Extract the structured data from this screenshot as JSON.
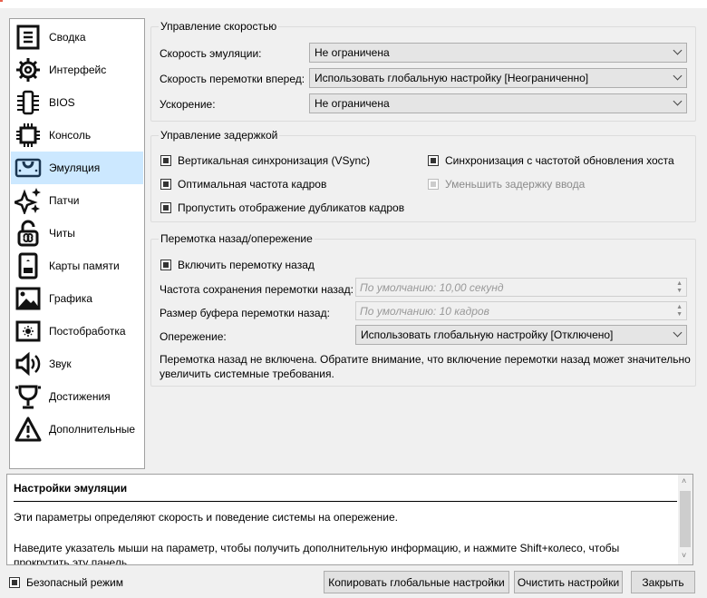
{
  "sidebar": {
    "items": [
      {
        "label": "Сводка",
        "icon": "summary-icon"
      },
      {
        "label": "Интерфейс",
        "icon": "gear-icon"
      },
      {
        "label": "BIOS",
        "icon": "bios-chip-icon"
      },
      {
        "label": "Консоль",
        "icon": "console-chip-icon"
      },
      {
        "label": "Эмуляция",
        "icon": "emulation-icon"
      },
      {
        "label": "Патчи",
        "icon": "sparkle-icon"
      },
      {
        "label": "Читы",
        "icon": "cheats-lock-icon"
      },
      {
        "label": "Карты памяти",
        "icon": "memory-card-icon"
      },
      {
        "label": "Графика",
        "icon": "image-icon"
      },
      {
        "label": "Постобработка",
        "icon": "post-processing-icon"
      },
      {
        "label": "Звук",
        "icon": "speaker-icon"
      },
      {
        "label": "Достижения",
        "icon": "trophy-icon"
      },
      {
        "label": "Дополнительные",
        "icon": "warning-icon"
      }
    ],
    "selected": "Эмуляция"
  },
  "speed": {
    "title": "Управление скоростью",
    "emulation_label": "Скорость эмуляции:",
    "emulation_value": "Не ограничена",
    "ff_label": "Скорость перемотки вперед:",
    "ff_value": "Использовать глобальную настройку [Неограниченно]",
    "turbo_label": "Ускорение:",
    "turbo_value": "Не ограничена"
  },
  "latency": {
    "title": "Управление задержкой",
    "vsync": "Вертикальная синхронизация (VSync)",
    "host_sync": "Синхронизация с частотой обновления хоста",
    "optimal": "Оптимальная частота кадров",
    "reduce_lag": "Уменьшить задержку ввода",
    "skip_dup": "Пропустить отображение дубликатов кадров"
  },
  "rewind": {
    "title": "Перемотка назад/опережение",
    "enable": "Включить перемотку назад",
    "freq_label": "Частота сохранения перемотки назад:",
    "freq_placeholder": "По умолчанию: 10,00 секунд",
    "buf_label": "Размер буфера перемотки назад:",
    "buf_placeholder": "По умолчанию: 10 кадров",
    "runahead_label": "Опережение:",
    "runahead_value": "Использовать глобальную настройку [Отключено]",
    "note": "Перемотка назад не включена. Обратите внимание, что включение перемотки назад может значительно увеличить системные требования."
  },
  "help": {
    "title": "Настройки эмуляции",
    "line1": "Эти параметры определяют скорость и поведение системы на опережение.",
    "line2": "Наведите указатель мыши на параметр, чтобы получить дополнительную информацию, и нажмите Shift+колесо, чтобы прокрутить эту панель."
  },
  "footer": {
    "safe_mode": "Безопасный режим",
    "copy": "Копировать глобальные настройки",
    "clear": "Очистить настройки",
    "close": "Закрыть"
  }
}
